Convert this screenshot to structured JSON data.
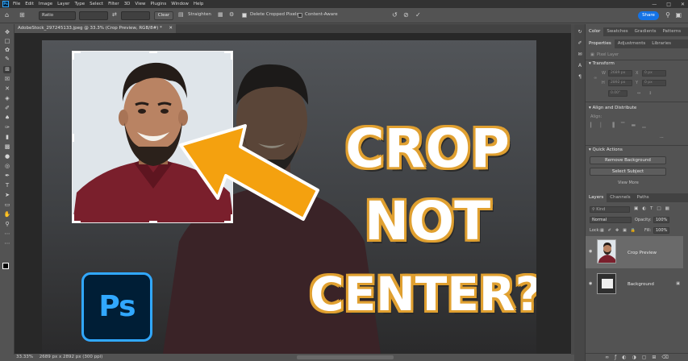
{
  "menubar": {
    "app_icon": "Ps",
    "items": [
      "File",
      "Edit",
      "Image",
      "Layer",
      "Type",
      "Select",
      "Filter",
      "3D",
      "View",
      "Plugins",
      "Window",
      "Help"
    ],
    "window_controls": [
      "minimize-icon",
      "maximize-icon",
      "close-icon"
    ]
  },
  "options": {
    "ratio_value": "Ratio",
    "clear_label": "Clear",
    "straighten_label": "Straighten",
    "delete_cropped_label": "Delete Cropped Pixels",
    "delete_cropped_checked": true,
    "content_aware_label": "Content-Aware",
    "content_aware_checked": false,
    "share_label": "Share"
  },
  "document": {
    "tab_title": "AdobeStock_297245133.jpeg @ 33.3% (Crop Preview, RGB/8#) *",
    "overlay_lines": [
      "CROP",
      "NOT",
      "CENTER?"
    ],
    "logo_text": "Ps"
  },
  "status": {
    "zoom": "33.33%",
    "dimensions": "2689 px x 2892 px (300 ppi)"
  },
  "panels": {
    "top_tabs": [
      "Color",
      "Swatches",
      "Gradients",
      "Patterns"
    ],
    "prop_tabs": [
      "Properties",
      "Adjustments",
      "Libraries"
    ],
    "pixel_layer_label": "Pixel Layer",
    "transform_label": "Transform",
    "w_label": "W",
    "h_label": "H",
    "x_label": "X",
    "y_label": "Y",
    "w_value": "2689 px",
    "h_value": "2892 px",
    "x_value": "0 px",
    "y_value": "0 px",
    "angle_value": "0.00°",
    "align_label": "Align and Distribute",
    "align_sub": "Align:",
    "quick_actions_label": "Quick Actions",
    "remove_bg_label": "Remove Background",
    "select_subject_label": "Select Subject",
    "view_more_label": "View More",
    "layers_tabs": [
      "Layers",
      "Channels",
      "Paths"
    ],
    "kind_placeholder": "Kind",
    "blend_mode": "Normal",
    "opacity_label": "Opacity:",
    "opacity_value": "100%",
    "lock_label": "Lock:",
    "fill_label": "Fill:",
    "fill_value": "100%",
    "layers": [
      {
        "name": "Crop Preview",
        "selected": true
      },
      {
        "name": "Background",
        "selected": false
      }
    ]
  },
  "colors": {
    "accent": "#31a8ff",
    "share": "#1473e6",
    "arrow": "#f4a10f",
    "shirt": "#7a1f2c"
  }
}
